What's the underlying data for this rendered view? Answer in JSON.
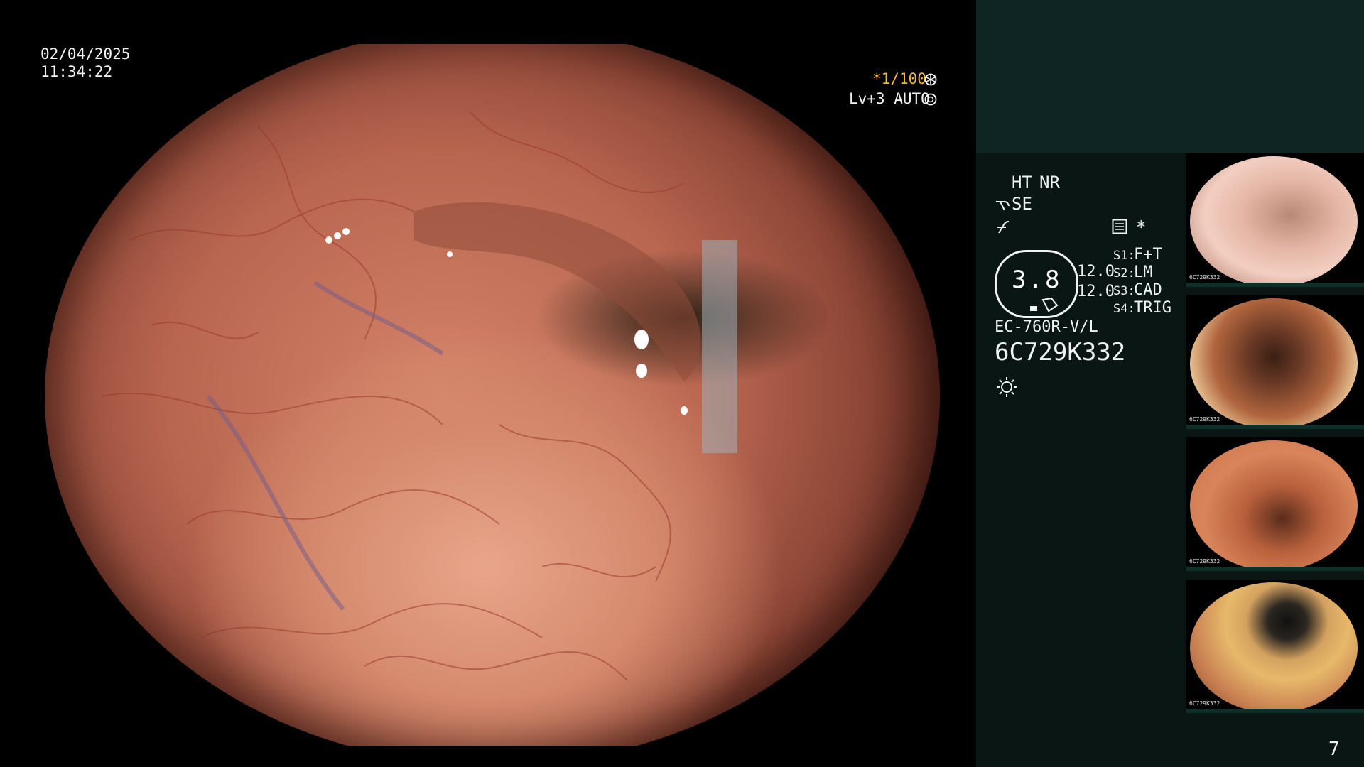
{
  "overlay": {
    "date": "02/04/2025",
    "time": "11:34:22",
    "shutter_prefix": "*",
    "shutter": "1/100",
    "level": "Lv+3",
    "mode": "AUTO"
  },
  "panel": {
    "ht": "HT",
    "nr": "NR",
    "se": "SE",
    "star": "*",
    "lens_value": "3.8",
    "num_top": "12.0",
    "num_bottom": "12.0",
    "s1_key": "S1:",
    "s1_val": "F+T",
    "s2_key": "S2:",
    "s2_val": "LM",
    "s3_key": "S3:",
    "s3_val": "CAD",
    "s4_key": "S4:",
    "s4_val": "TRIG",
    "scope_model": "EC-760R-V/L",
    "serial": "6C729K332"
  },
  "thumbnails": [
    {
      "label": "6C729K332"
    },
    {
      "label": "6C729K332"
    },
    {
      "label": "6C729K332"
    },
    {
      "label": "6C729K332"
    }
  ],
  "page_number": "7",
  "colors": {
    "accent_yellow": "#f0b935",
    "panel_bg": "#0a1614",
    "panel_top_bg": "#0f2523"
  }
}
